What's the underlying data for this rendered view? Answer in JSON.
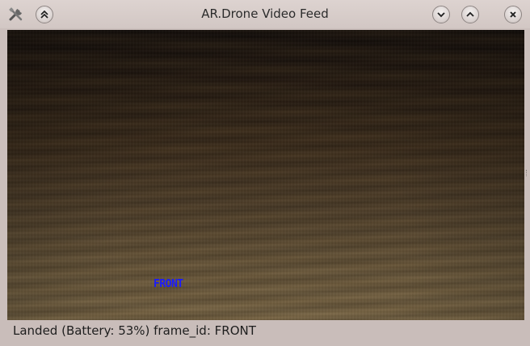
{
  "window": {
    "title": "AR.Drone Video Feed"
  },
  "titlebar": {
    "icons": {
      "app": "tools-icon",
      "keep_above": "chevron-double-up-icon",
      "minimize": "chevron-down-icon",
      "maximize": "chevron-up-icon",
      "close": "close-icon"
    }
  },
  "video": {
    "overlay_label": "FRONT",
    "overlay_color": "#1a1aff"
  },
  "status_bar": {
    "text": "Landed (Battery: 53%) frame_id: FRONT"
  }
}
